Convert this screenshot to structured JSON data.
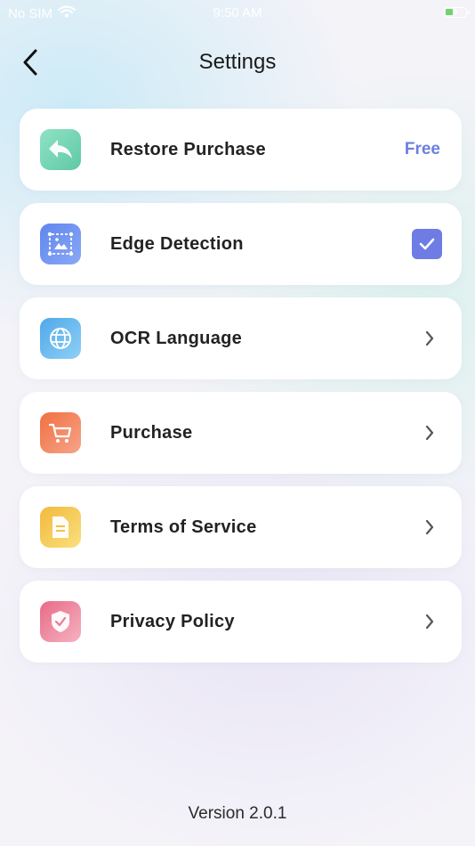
{
  "status_bar": {
    "carrier": "No SIM",
    "time": "9:50 AM"
  },
  "nav": {
    "title": "Settings"
  },
  "settings": [
    {
      "label": "Restore Purchase",
      "icon": "reply-arrow-icon",
      "accessory": "Free"
    },
    {
      "label": "Edge Detection",
      "icon": "image-frame-icon",
      "accessory_state": "checked"
    },
    {
      "label": "OCR Language",
      "icon": "globe-icon"
    },
    {
      "label": "Purchase",
      "icon": "cart-icon"
    },
    {
      "label": "Terms of Service",
      "icon": "document-icon"
    },
    {
      "label": "Privacy Policy",
      "icon": "shield-check-icon"
    }
  ],
  "footer": {
    "version": "Version 2.0.1"
  },
  "colors": {
    "accent": "#6b7fe0",
    "checkbox": "#6e7ce4"
  }
}
